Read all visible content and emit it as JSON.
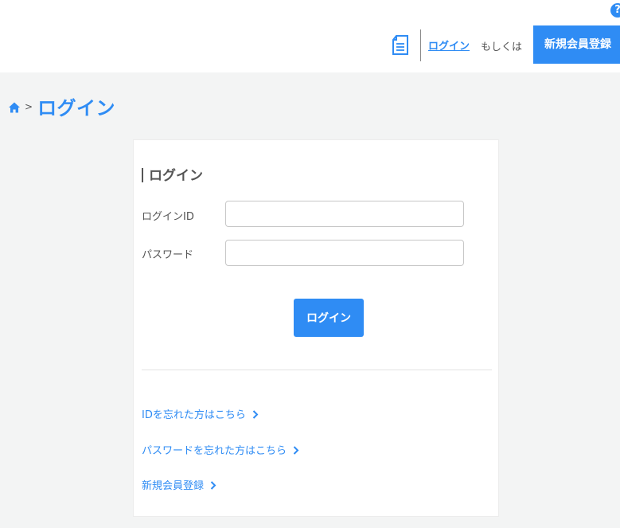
{
  "header": {
    "help_label": "?",
    "login_link": "ログイン",
    "or_text": "もしくは",
    "register_button": "新規会員登録"
  },
  "breadcrumb": {
    "separator": ">",
    "title": "ログイン"
  },
  "login_form": {
    "section_title": "ログイン",
    "login_id_label": "ログインID",
    "login_id_value": "",
    "password_label": "パスワード",
    "password_value": "",
    "submit_label": "ログイン"
  },
  "links": {
    "forgot_id": "IDを忘れた方はこちら",
    "forgot_password": "パスワードを忘れた方はこちら",
    "register": "新規会員登録"
  },
  "colors": {
    "accent": "#2f8cf4",
    "background": "#f3f4f4",
    "text": "#555555"
  },
  "icons": [
    "help-icon",
    "document-icon",
    "home-icon",
    "chevron-right-icon"
  ]
}
